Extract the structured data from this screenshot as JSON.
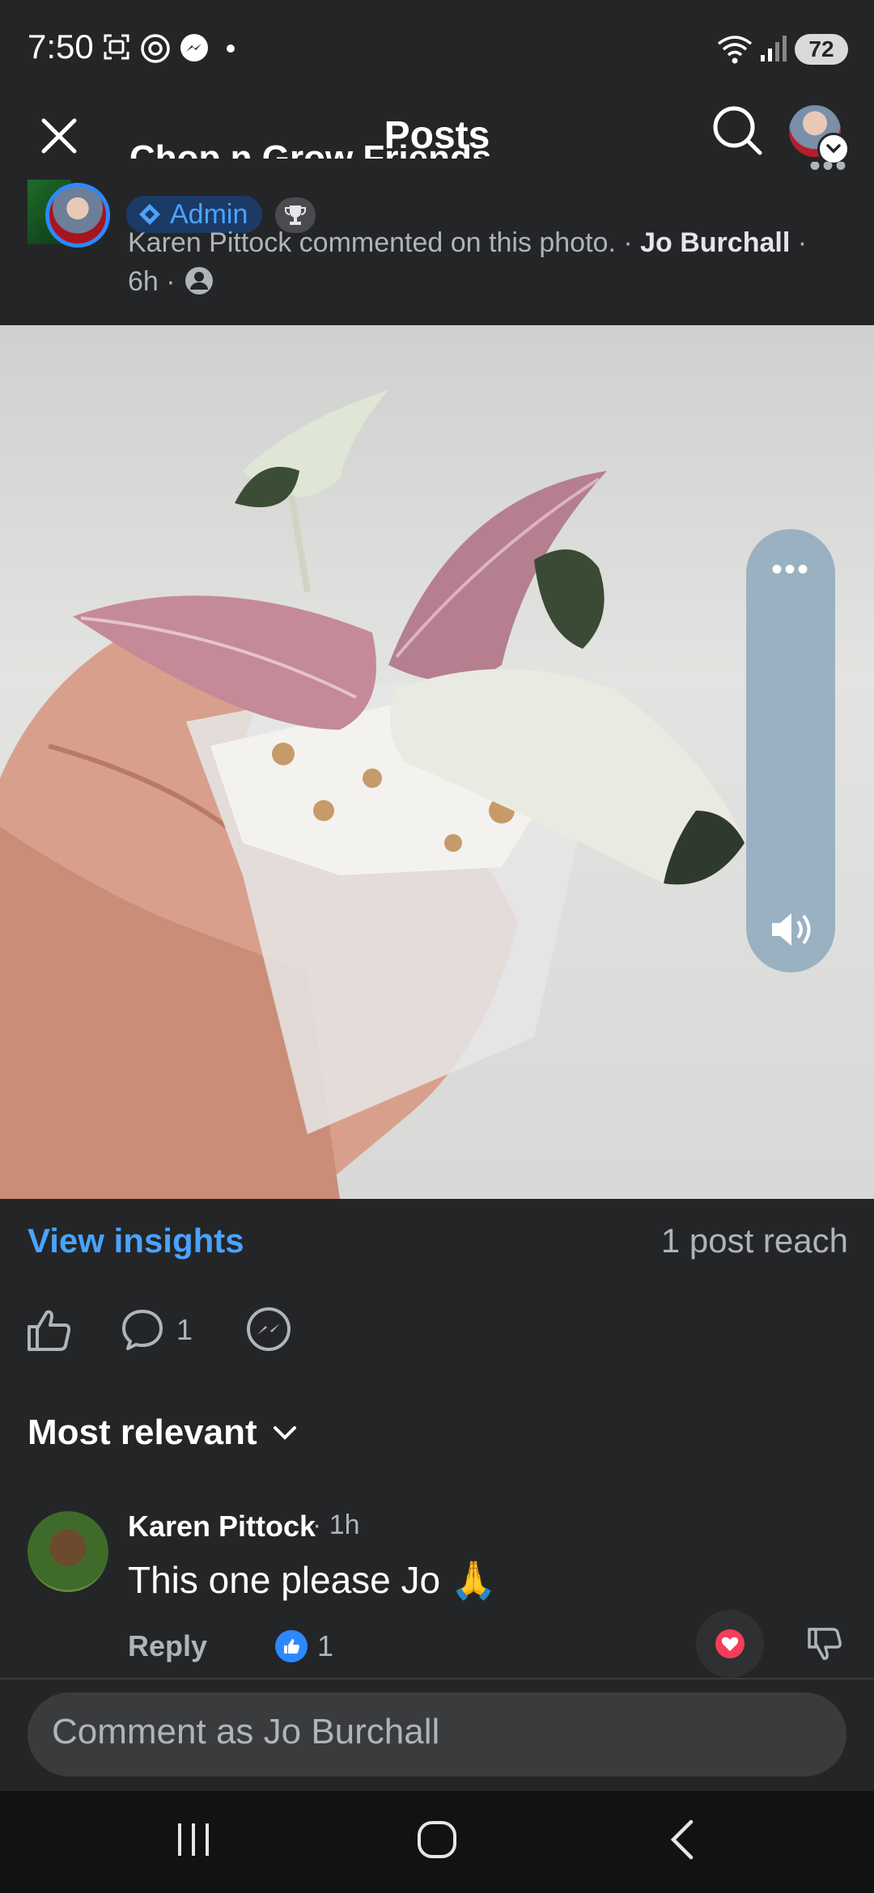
{
  "status_bar": {
    "time": "7:50",
    "battery": "72"
  },
  "header": {
    "title": "Posts"
  },
  "post": {
    "group_name": "Chop n Grow Friends",
    "admin_label": "Admin",
    "activity_text": "Karen Pittock commented on this photo. · ",
    "author": "Jo Burchall",
    "time": " · 6h · "
  },
  "insights": {
    "view_insights": "View insights",
    "reach": "1 post reach"
  },
  "actions": {
    "comment_count": "1"
  },
  "sort": {
    "label": "Most relevant"
  },
  "comment": {
    "author": "Karen Pittock",
    "time": "· 1h",
    "text": "This one please Jo 🙏",
    "reply_label": "Reply",
    "like_count": "1"
  },
  "composer": {
    "placeholder": "Comment as Jo Burchall"
  },
  "colors": {
    "accent": "#4aa3ff",
    "background": "#242527",
    "love": "#f33e58"
  }
}
